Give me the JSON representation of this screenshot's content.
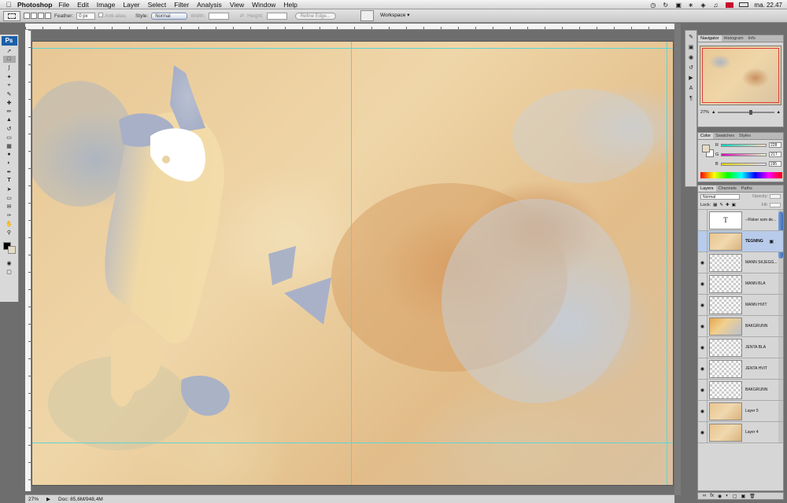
{
  "menubar": {
    "app_name": "Photoshop",
    "items": [
      "File",
      "Edit",
      "Image",
      "Layer",
      "Select",
      "Filter",
      "Analysis",
      "View",
      "Window",
      "Help"
    ],
    "clock": "ma. 22.47"
  },
  "options": {
    "feather_label": "Feather:",
    "feather_value": "0 px",
    "anti_alias_label": "Anti-alias",
    "style_label": "Style:",
    "style_value": "Normal",
    "width_label": "Width:",
    "height_label": "Height:",
    "refine_label": "Refine Edge...",
    "workspace_label": "Workspace ▾"
  },
  "toolbox": {
    "logo": "Ps"
  },
  "status": {
    "zoom": "27%",
    "doc": "Doc: 85,6M/948,4M"
  },
  "navigator": {
    "tabs": [
      "Navigator",
      "Histogram",
      "Info"
    ],
    "zoom": "27%",
    "zoom_fraction": 0.55
  },
  "color_panel": {
    "tabs": [
      "Color",
      "Swatches",
      "Styles"
    ],
    "channels": [
      {
        "label": "R",
        "value": "228"
      },
      {
        "label": "G",
        "value": "217"
      },
      {
        "label": "B",
        "value": "195"
      }
    ],
    "fg_color": "#e6dcc4"
  },
  "layers_panel": {
    "tabs": [
      "Layers",
      "Channels",
      "Paths"
    ],
    "blend_mode": "Normal",
    "opacity_label": "Opacity:",
    "lock_label": "Lock:",
    "fill_label": "Fill:",
    "layers": [
      {
        "name": "--Floker som de...",
        "visible": false,
        "thumb": "text"
      },
      {
        "name": "TEGNING",
        "visible": false,
        "thumb": "paint",
        "selected": true,
        "locked": true
      },
      {
        "name": "MANN SKJEGG...",
        "visible": true,
        "thumb": "trans"
      },
      {
        "name": "MANN BLÅ",
        "visible": true,
        "thumb": "trans"
      },
      {
        "name": "MANN HVIT",
        "visible": true,
        "thumb": "trans"
      },
      {
        "name": "BAKGRUNN",
        "visible": true,
        "thumb": "bk"
      },
      {
        "name": "JENTA BLÅ",
        "visible": true,
        "thumb": "trans"
      },
      {
        "name": "JENTA HVIT",
        "visible": true,
        "thumb": "trans"
      },
      {
        "name": "BAKGRUNN",
        "visible": true,
        "thumb": "trans"
      },
      {
        "name": "Layer 5",
        "visible": true,
        "thumb": "paint"
      },
      {
        "name": "Layer 4",
        "visible": true,
        "thumb": "paint"
      }
    ]
  }
}
